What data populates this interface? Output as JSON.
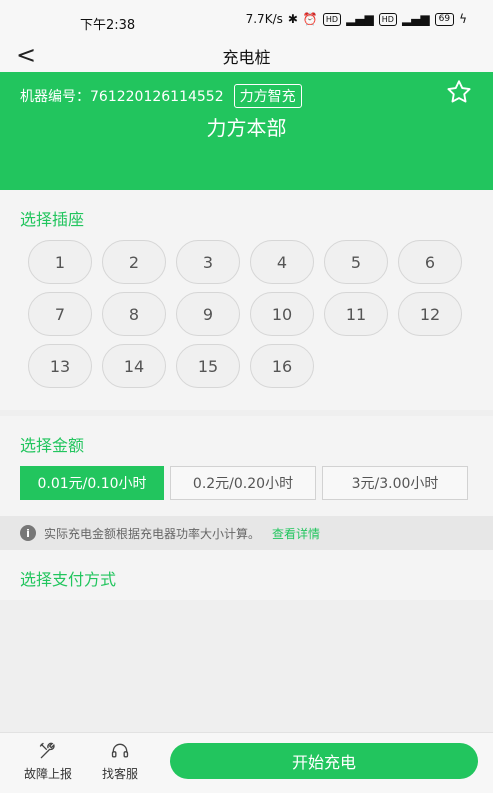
{
  "status_bar": {
    "time": "下午2:38",
    "speed": "7.7K/s",
    "hd_badge": "HD",
    "battery": "69"
  },
  "nav": {
    "title": "充电桩",
    "back_label": "<"
  },
  "header": {
    "machine_label": "机器编号：761220126114552",
    "brand": "力方智充",
    "station_name": "力方本部"
  },
  "socket_section": {
    "title": "选择插座",
    "sockets": [
      "1",
      "2",
      "3",
      "4",
      "5",
      "6",
      "7",
      "8",
      "9",
      "10",
      "11",
      "12",
      "13",
      "14",
      "15",
      "16"
    ]
  },
  "amount_section": {
    "title": "选择金额",
    "options": [
      "0.01元/0.10小时",
      "0.2元/0.20小时",
      "3元/3.00小时"
    ]
  },
  "notice": {
    "icon": "i",
    "text": "实际充电金额根据充电器功率大小计算。",
    "link": "查看详情"
  },
  "payment_section": {
    "title": "选择支付方式"
  },
  "bottom_bar": {
    "report": "故障上报",
    "service": "找客服",
    "start": "开始充电"
  },
  "colors": {
    "accent": "#22c55e"
  }
}
